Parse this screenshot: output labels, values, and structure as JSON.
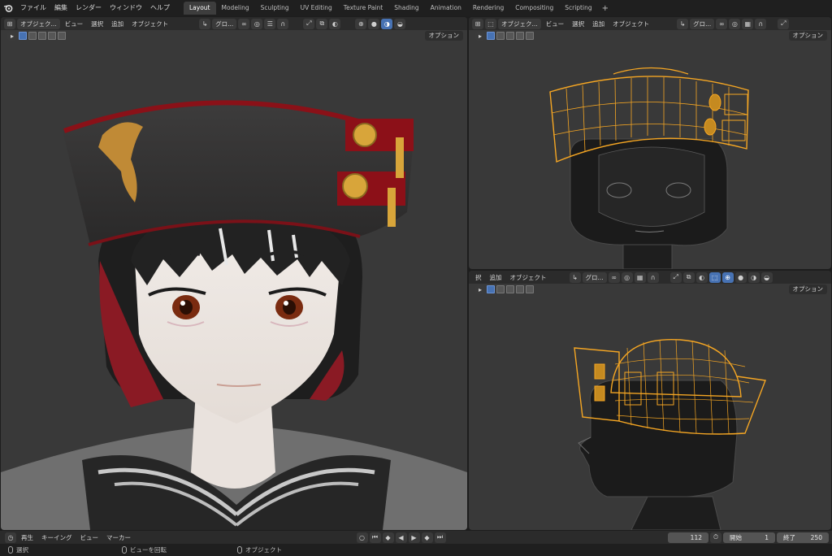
{
  "topbar": {
    "menus": [
      "ファイル",
      "編集",
      "レンダー",
      "ウィンドウ",
      "ヘルプ"
    ],
    "workspaces": [
      "Layout",
      "Modeling",
      "Sculpting",
      "UV Editing",
      "Texture Paint",
      "Shading",
      "Animation",
      "Rendering",
      "Compositing",
      "Scripting"
    ],
    "active_workspace": "Layout",
    "add_label": "+"
  },
  "viewport_main": {
    "mode": "オブジェク...",
    "menus": [
      "ビュー",
      "選択",
      "追加",
      "オブジェクト"
    ],
    "orientation": "グロ...",
    "options": "オプション"
  },
  "viewport_top_right": {
    "mode": "オブジェク...",
    "menus": [
      "ビュー",
      "選択",
      "追加",
      "オブジェクト"
    ],
    "orientation": "グロ...",
    "options": "オプション"
  },
  "viewport_bottom_right": {
    "menus": [
      "択",
      "追加",
      "オブジェクト"
    ],
    "orientation": "グロ...",
    "options": "オプション"
  },
  "timeline": {
    "playback": "再生",
    "keying": "キーイング",
    "view": "ビュー",
    "marker": "マーカー",
    "current_frame": "112",
    "start_label": "開始",
    "start": "1",
    "end_label": "終了",
    "end": "250"
  },
  "statusbar": {
    "select": "選択",
    "rotate_view": "ビューを回転",
    "object": "オブジェクト"
  },
  "colors": {
    "accent": "#4772b3",
    "wire_selected": "#f5a623",
    "viewport_bg": "#393939"
  }
}
